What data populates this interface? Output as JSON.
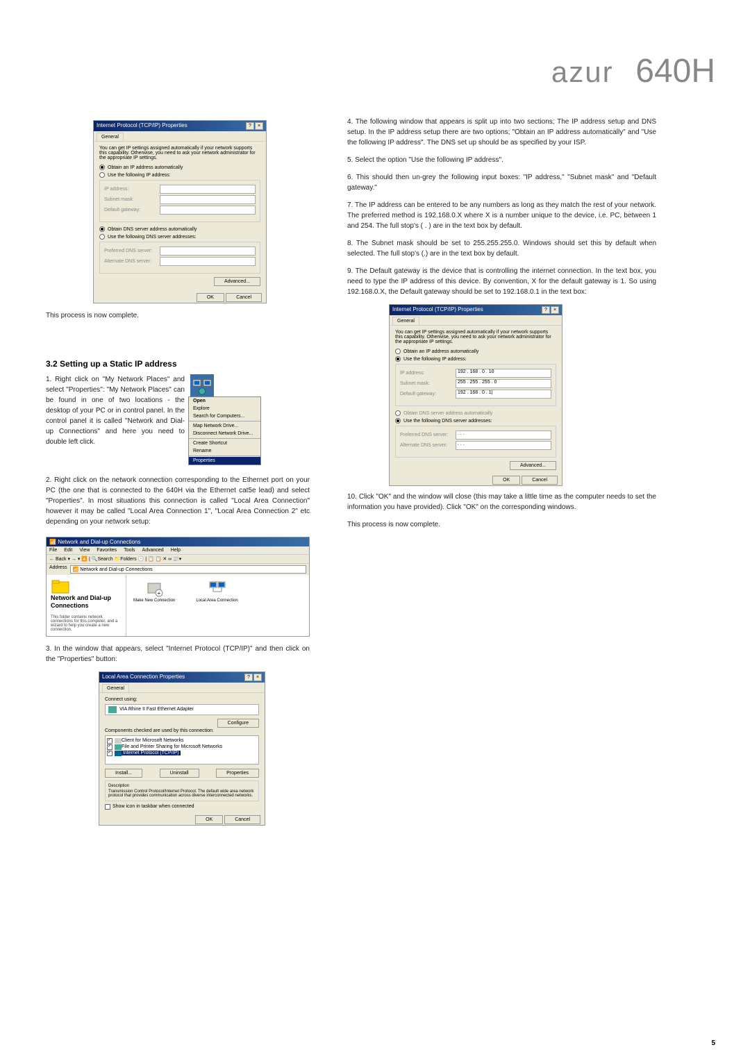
{
  "header": {
    "brand": "azur",
    "model": "640H"
  },
  "pageNum": "5",
  "dialog1": {
    "title": "Internet Protocol (TCP/IP) Properties",
    "tab": "General",
    "intro": "You can get IP settings assigned automatically if your network supports this capability. Otherwise, you need to ask your network administrator for the appropriate IP settings.",
    "radio1": "Obtain an IP address automatically",
    "radio2": "Use the following IP address:",
    "ipLabel": "IP address:",
    "subnetLabel": "Subnet mask:",
    "gatewayLabel": "Default gateway:",
    "radio3": "Obtain DNS server address automatically",
    "radio4": "Use the following DNS server addresses:",
    "prefDns": "Preferred DNS server:",
    "altDns": "Alternate DNS server:",
    "advanced": "Advanced...",
    "ok": "OK",
    "cancel": "Cancel"
  },
  "caption1": "This process is now complete.",
  "section32": {
    "heading": "3.2 Setting up a Static IP address",
    "step1": "1. Right click on \"My Network Places\" and select \"Properties\": \"My Network Places\" can be found in one of two locations - the desktop of your PC or in control panel. In the control panel it is called \"Network and Dial-up Connections\" and here you need to double left click.",
    "step2": "2. Right click on the network connection corresponding to the Ethernet port on your PC (the one that is connected to the 640H via the Ethernet cat5e lead) and select \"Properties\". In most situations this connection is called \"Local Area Connection\" however it may be called \"Local Area Connection 1\", \"Local Area Connection 2\" etc depending on your network setup:",
    "step3": "3. In the window that appears, select \"Internet Protocol (TCP/IP)\" and then click on the \"Properties\" button:"
  },
  "contextMenu": {
    "open": "Open",
    "explore": "Explore",
    "search": "Search for Computers...",
    "map": "Map Network Drive...",
    "disconnect": "Disconnect Network Drive...",
    "shortcut": "Create Shortcut",
    "rename": "Rename",
    "properties": "Properties"
  },
  "explorer": {
    "title": "Network and Dial-up Connections",
    "menu": [
      "File",
      "Edit",
      "View",
      "Favorites",
      "Tools",
      "Advanced",
      "Help"
    ],
    "address": "Address",
    "addressVal": "Network and Dial-up Connections",
    "leftTitle": "Network and Dial-up Connections",
    "leftText": "This folder contains network connections for this computer, and a wizard to help you create a new connection.",
    "icon1": "Make New Connection",
    "icon2": "Local Area Connection",
    "toolbar": "← Back  ▾  →  ▾  🔼  |  🔍Search  📁Folders  🕒  |  📋 📋 ✕ ∞  📰▾"
  },
  "lanDialog": {
    "title": "Local Area Connection Properties",
    "tab": "General",
    "connectUsing": "Connect using:",
    "adapter": "VIA Rhine II Fast Ethernet Adapter",
    "configure": "Configure",
    "compText": "Components checked are used by this connection:",
    "comp1": "Client for Microsoft Networks",
    "comp2": "File and Printer Sharing for Microsoft Networks",
    "comp3": "Internet Protocol (TCP/IP)",
    "install": "Install...",
    "uninstall": "Uninstall",
    "properties": "Properties",
    "descLabel": "Description",
    "desc": "Transmission Control Protocol/Internet Protocol. The default wide area network protocol that provides communication across diverse interconnected networks.",
    "taskbar": "Show icon in taskbar when connected",
    "ok": "OK",
    "cancel": "Cancel"
  },
  "rightSteps": {
    "step4": "4. The following window that appears is split up into two sections; The IP address setup and DNS setup. In the IP address setup there are two options; \"Obtain an IP address automatically\" and \"Use the following IP address\". The DNS set up should be as specified by your ISP.",
    "step5": "5. Select the option \"Use the following IP address\".",
    "step6": "6. This should then un-grey the following input boxes: \"IP address,\" \"Subnet mask\" and \"Default gateway.\"",
    "step7": "7. The IP address can be entered to be any numbers as long as they match the rest of your network. The preferred method is 192.168.0.X where X is a number unique to the device, i.e. PC, between 1 and 254. The full stop's ( . ) are in the text box by default.",
    "step8": "8. The Subnet mask should be set to 255.255.255.0. Windows should set this by default when selected. The full stop's (.) are in the text box by default.",
    "step9": "9. The Default gateway is the device that is controlling the internet connection. In the text box, you need to type the IP address of this device. By convention, X for the default gateway is 1. So using 192.168.0.X, the Default gateway should be set to 192.168.0.1 in the text box:",
    "step10": "10. Click \"OK\" and the window will close (this may take a little time as the computer needs to set the information you have provided). Click \"OK\" on the corresponding windows.",
    "complete": "This process is now complete."
  },
  "dialog2": {
    "ipVal": "192 . 168 .  0  . 10",
    "subnetVal": "255 . 255 . 255 .  0",
    "gatewayVal": "192 . 168 .  0  .  1|"
  }
}
